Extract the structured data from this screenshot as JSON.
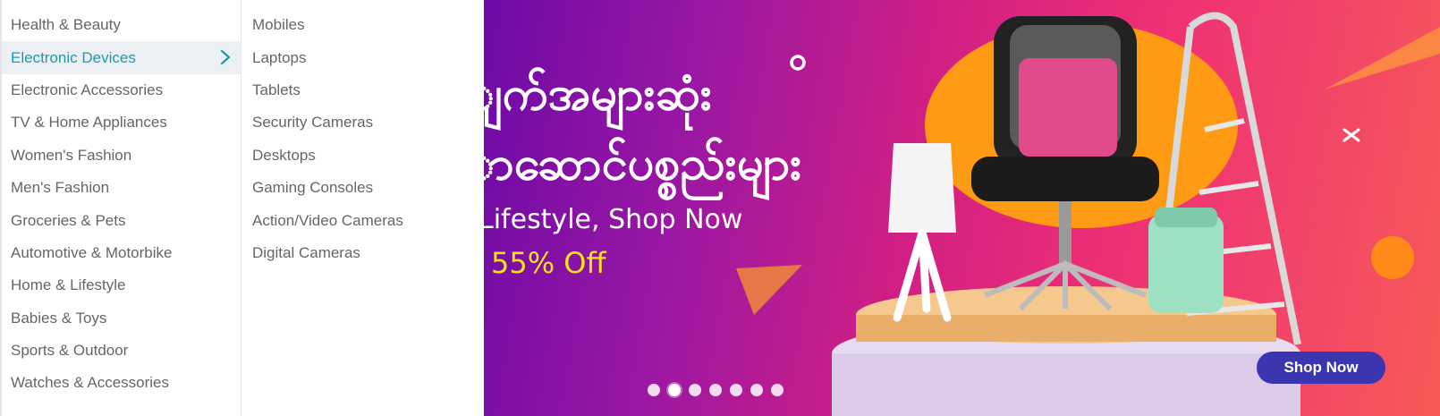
{
  "categories": [
    {
      "label": "Health & Beauty"
    },
    {
      "label": "Electronic Devices"
    },
    {
      "label": "Electronic Accessories"
    },
    {
      "label": "TV & Home Appliances"
    },
    {
      "label": "Women's Fashion"
    },
    {
      "label": "Men's Fashion"
    },
    {
      "label": "Groceries & Pets"
    },
    {
      "label": "Automotive & Motorbike"
    },
    {
      "label": "Home & Lifestyle"
    },
    {
      "label": "Babies & Toys"
    },
    {
      "label": "Sports & Outdoor"
    },
    {
      "label": "Watches & Accessories"
    }
  ],
  "active_category_icon": "chevron-right-icon",
  "subcategories": [
    {
      "label": "Mobiles"
    },
    {
      "label": "Laptops"
    },
    {
      "label": "Tablets"
    },
    {
      "label": "Security Cameras"
    },
    {
      "label": "Desktops"
    },
    {
      "label": "Gaming Consoles"
    },
    {
      "label": "Action/Video Cameras"
    },
    {
      "label": "Digital Cameras"
    }
  ],
  "banner": {
    "headline_line1": "ျက်အများဆုံး",
    "headline_line2": "ာဆောင်ပစ္စည်းများ",
    "subline": "Lifestyle, Shop Now",
    "discount": "55% Off",
    "shop_button": "Shop Now",
    "slide_count": 7,
    "active_slide": 2
  },
  "colors": {
    "active_text": "#1a9cb0",
    "menu_text": "#666666",
    "discount": "#ffe11a",
    "button_bg": "#3b36b0"
  }
}
